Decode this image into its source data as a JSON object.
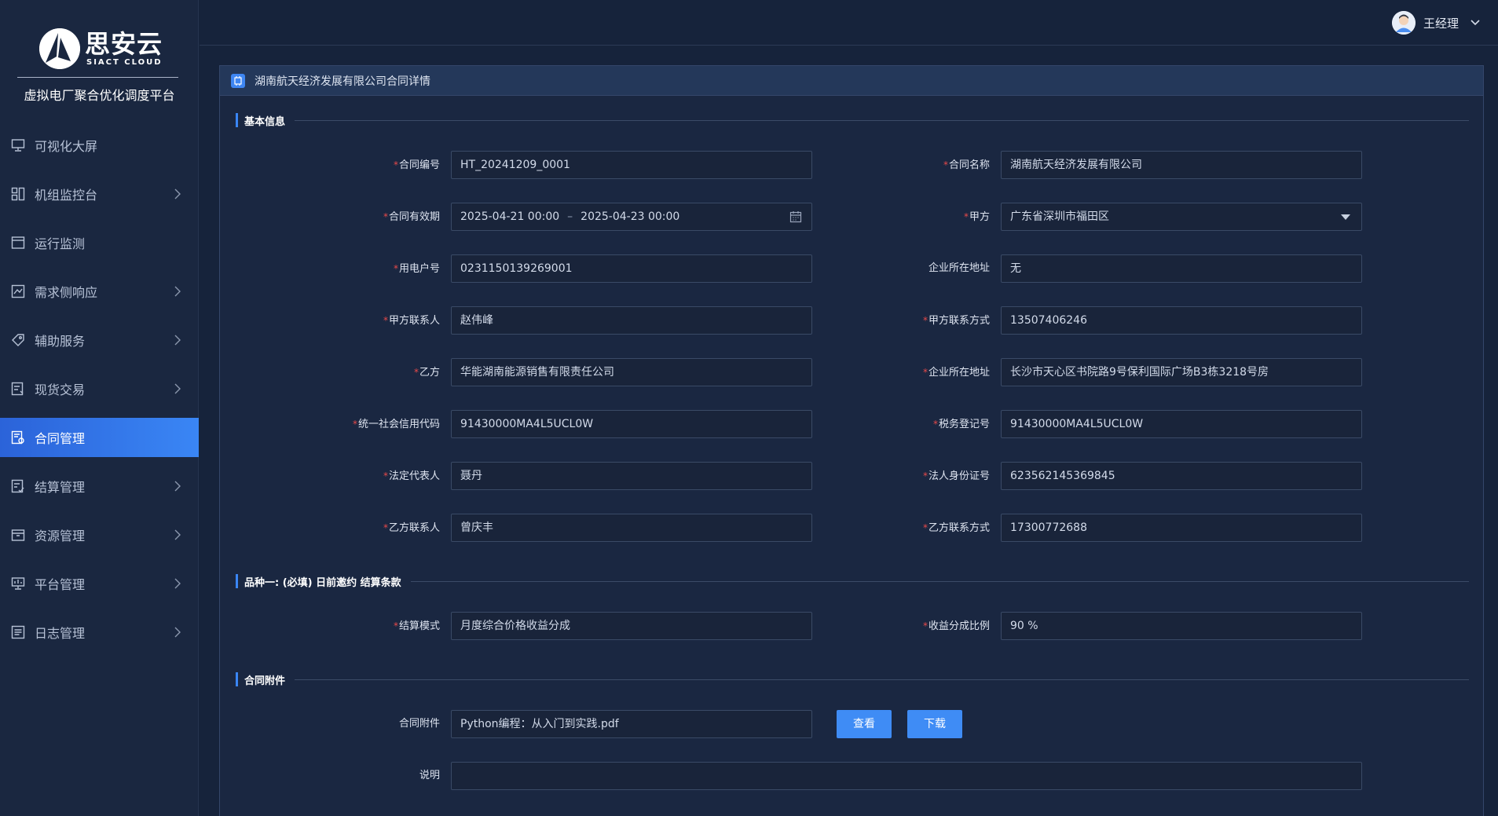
{
  "brand": {
    "name": "思安云",
    "sub": "SIACT CLOUD",
    "platform": "虚拟电厂聚合优化调度平台"
  },
  "user": {
    "name": "王经理"
  },
  "menu": {
    "items": [
      {
        "label": "可视化大屏"
      },
      {
        "label": "机组监控台"
      },
      {
        "label": "运行监测"
      },
      {
        "label": "需求侧响应"
      },
      {
        "label": "辅助服务"
      },
      {
        "label": "现货交易"
      },
      {
        "label": "合同管理"
      },
      {
        "label": "结算管理"
      },
      {
        "label": "资源管理"
      },
      {
        "label": "平台管理"
      },
      {
        "label": "日志管理"
      }
    ]
  },
  "panel": {
    "title": "湖南航天经济发展有限公司合同详情"
  },
  "sections": {
    "basic": "基本信息",
    "variety": "品种一: (必填) 日前邀约 结算条款",
    "attachment": "合同附件"
  },
  "form": {
    "contract_no": {
      "label": "合同编号",
      "value": "HT_20241209_0001"
    },
    "contract_name": {
      "label": "合同名称",
      "value": "湖南航天经济发展有限公司"
    },
    "validity": {
      "label": "合同有效期",
      "start": "2025-04-21 00:00",
      "sep": "–",
      "end": "2025-04-23 00:00"
    },
    "party_a": {
      "label": "甲方",
      "value": "广东省深圳市福田区"
    },
    "user_no": {
      "label": "用电户号",
      "value": "0231150139269001"
    },
    "addr_a": {
      "label": "企业所在地址",
      "value": "无"
    },
    "contact_a": {
      "label": "甲方联系人",
      "value": "赵伟峰"
    },
    "phone_a": {
      "label": "甲方联系方式",
      "value": "13507406246"
    },
    "party_b": {
      "label": "乙方",
      "value": "华能湖南能源销售有限责任公司"
    },
    "addr_b": {
      "label": "企业所在地址",
      "value": "长沙市天心区书院路9号保利国际广场B3栋3218号房"
    },
    "credit_code": {
      "label": "统一社会信用代码",
      "value": "91430000MA4L5UCL0W"
    },
    "tax_no": {
      "label": "税务登记号",
      "value": "91430000MA4L5UCL0W"
    },
    "legal_rep": {
      "label": "法定代表人",
      "value": "聂丹"
    },
    "legal_id": {
      "label": "法人身份证号",
      "value": "623562145369845"
    },
    "contact_b": {
      "label": "乙方联系人",
      "value": "曾庆丰"
    },
    "phone_b": {
      "label": "乙方联系方式",
      "value": "17300772688"
    },
    "settle_mode": {
      "label": "结算模式",
      "value": "月度综合价格收益分成"
    },
    "share_ratio": {
      "label": "收益分成比例",
      "value": "90 %"
    },
    "attachment": {
      "label": "合同附件",
      "value": "Python编程：从入门到实践.pdf"
    },
    "remark": {
      "label": "说明",
      "value": ""
    }
  },
  "buttons": {
    "view": "查看",
    "download": "下载"
  }
}
